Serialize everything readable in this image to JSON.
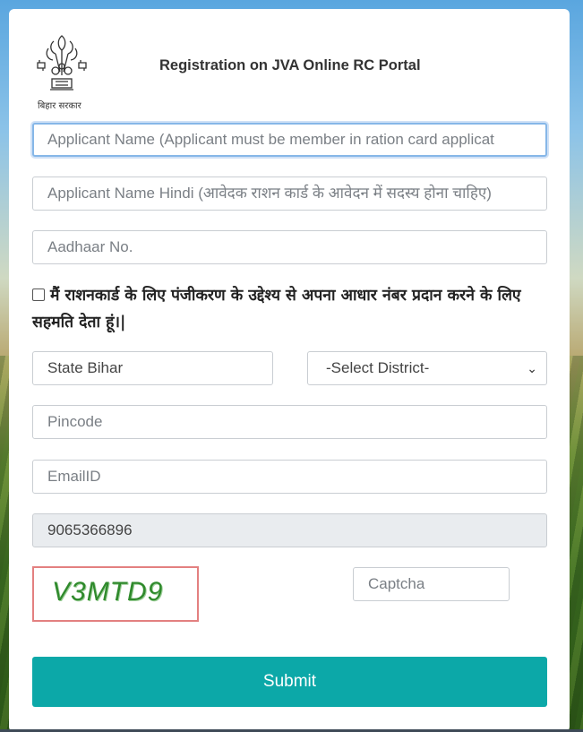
{
  "header": {
    "title": "Registration on JVA Online RC Portal",
    "logo_caption": "बिहार सरकार"
  },
  "form": {
    "applicant_name_placeholder": "Applicant Name (Applicant must be member in ration card applicat",
    "applicant_name_hindi_placeholder": "Applicant Name Hindi (आवेदक राशन कार्ड के आवेदन में सदस्य होना चाहिए)",
    "aadhaar_placeholder": "Aadhaar No.",
    "consent_text": "मैं राशनकार्ड के लिए पंजीकरण के उद्देश्य से अपना आधार नंबर प्रदान करने के लिए सहमति देता हूं।|",
    "consent_checked": false,
    "state_value": "State Bihar",
    "district_selected": "-Select District-",
    "pincode_placeholder": "Pincode",
    "email_placeholder": "EmailID",
    "mobile_value": "9065366896",
    "captcha_image_text": "V3MTD9",
    "captcha_placeholder": "Captcha",
    "submit_label": "Submit"
  },
  "colors": {
    "submit_bg": "#0ca8a8",
    "captcha_border": "#e38080",
    "captcha_text": "#2f8a2c"
  }
}
